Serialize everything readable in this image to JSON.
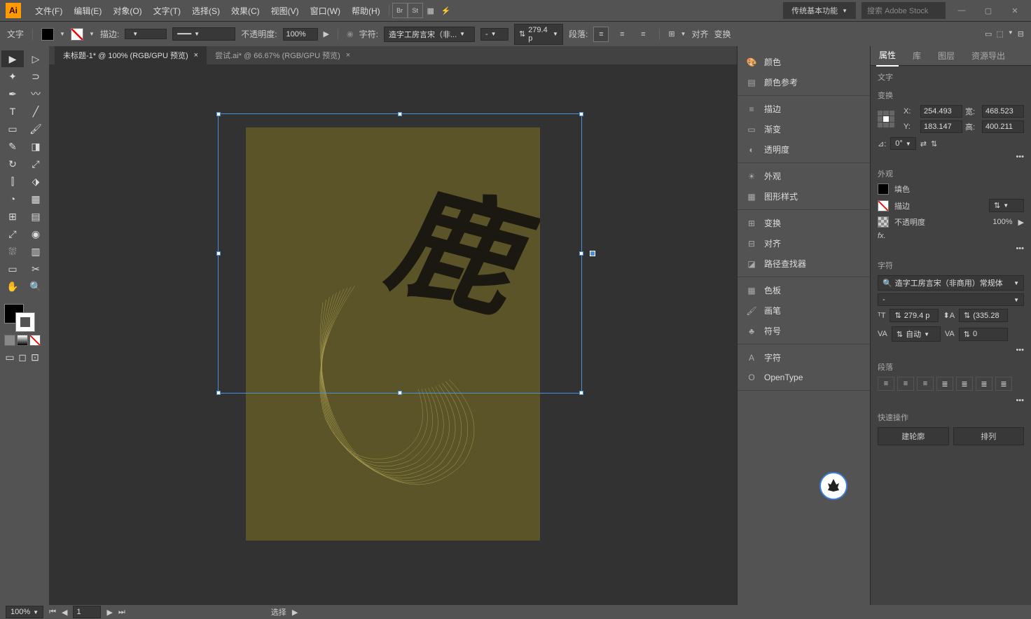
{
  "app": {
    "logo": "Ai"
  },
  "menu": [
    "文件(F)",
    "编辑(E)",
    "对象(O)",
    "文字(T)",
    "选择(S)",
    "效果(C)",
    "视图(V)",
    "窗口(W)",
    "帮助(H)"
  ],
  "titlebar": {
    "workspace": "传统基本功能",
    "search_placeholder": "搜索 Adobe Stock"
  },
  "options": {
    "tool_label": "文字",
    "stroke_label": "描边:",
    "opacity_label": "不透明度:",
    "opacity_value": "100%",
    "char_label": "字符:",
    "font_name": "造字工房言宋（非...",
    "font_style": "-",
    "font_size": "279.4 p",
    "para_label": "段落:",
    "align_label": "对齐",
    "transform_label": "变换"
  },
  "tabs": [
    {
      "label": "未标题-1* @ 100% (RGB/GPU 预览)",
      "active": true
    },
    {
      "label": "尝试.ai* @ 66.67% (RGB/GPU 预览)",
      "active": false
    }
  ],
  "mid_panels": {
    "groups": [
      [
        "颜色",
        "颜色参考"
      ],
      [
        "描边",
        "渐变",
        "透明度"
      ],
      [
        "外观",
        "图形样式"
      ],
      [
        "变换",
        "对齐",
        "路径查找器"
      ],
      [
        "色板",
        "画笔",
        "符号"
      ],
      [
        "字符",
        "OpenType"
      ]
    ]
  },
  "props": {
    "tabs": [
      "属性",
      "库",
      "图层",
      "资源导出"
    ],
    "selection_type": "文字",
    "transform": {
      "label": "变换",
      "x_label": "X:",
      "x": "254.493",
      "y_label": "Y:",
      "y": "183.147",
      "w_label": "宽:",
      "w": "468.523",
      "h_label": "高:",
      "h": "400.211",
      "angle_label": "⊿:",
      "angle": "0°"
    },
    "appearance": {
      "label": "外观",
      "fill_label": "填色",
      "stroke_label": "描边",
      "opacity_label": "不透明度",
      "opacity": "100%",
      "fx_label": "fx."
    },
    "character": {
      "label": "字符",
      "font": "造字工房言宋（非商用）常规体",
      "style": "-",
      "size": "279.4 p",
      "leading": "(335.28",
      "kerning": "自动",
      "tracking": "0"
    },
    "paragraph": {
      "label": "段落"
    },
    "quick": {
      "label": "快速操作",
      "outline": "建轮廓",
      "arrange": "排列"
    }
  },
  "status": {
    "zoom": "100%",
    "page": "1",
    "tool": "选择"
  }
}
